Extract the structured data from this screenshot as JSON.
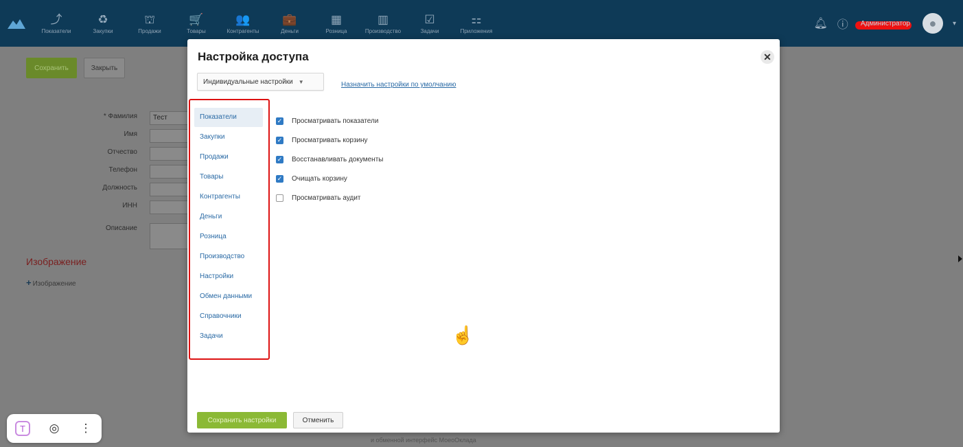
{
  "nav": {
    "items": [
      {
        "label": "Показатели",
        "icon": "chart-line-icon",
        "glyph": "⤴"
      },
      {
        "label": "Закупки",
        "icon": "purchases-icon",
        "glyph": "♻"
      },
      {
        "label": "Продажи",
        "icon": "bag-icon",
        "glyph": "⛫"
      },
      {
        "label": "Товары",
        "icon": "cart-icon",
        "glyph": "🛒"
      },
      {
        "label": "Контрагенты",
        "icon": "people-icon",
        "glyph": "👥"
      },
      {
        "label": "Деньги",
        "icon": "wallet-icon",
        "glyph": "💼"
      },
      {
        "label": "Розница",
        "icon": "register-icon",
        "glyph": "▦"
      },
      {
        "label": "Производство",
        "icon": "factory-icon",
        "glyph": "▥"
      },
      {
        "label": "Задачи",
        "icon": "tasks-icon",
        "glyph": "☑"
      },
      {
        "label": "Приложения",
        "icon": "apps-icon",
        "glyph": "⚏"
      }
    ],
    "user": "Администратор"
  },
  "page": {
    "save_label": "Сохранить",
    "close_label": "Закрыть",
    "fields": [
      {
        "label": "* Фамилия",
        "value": "Тест"
      },
      {
        "label": "Имя",
        "value": ""
      },
      {
        "label": "Отчество",
        "value": ""
      },
      {
        "label": "Телефон",
        "value": ""
      },
      {
        "label": "Должность",
        "value": ""
      },
      {
        "label": "ИНН",
        "value": ""
      },
      {
        "label": "Описание",
        "value": ""
      }
    ],
    "image_title": "Изображение",
    "image_add": "Изображение",
    "footer_note": "и обменной интерфейс МоеоОклада"
  },
  "modal": {
    "title": "Настройка доступа",
    "select_value": "Индивидуальные настройки",
    "default_link": "Назначить настройки по умолчанию",
    "sections": [
      "Показатели",
      "Закупки",
      "Продажи",
      "Товары",
      "Контрагенты",
      "Деньги",
      "Розница",
      "Производство",
      "Настройки",
      "Обмен данными",
      "Справочники",
      "Задачи"
    ],
    "active_section": "Показатели",
    "permissions": [
      {
        "label": "Просматривать показатели",
        "checked": true
      },
      {
        "label": "Просматривать корзину",
        "checked": true
      },
      {
        "label": "Восстанавливать документы",
        "checked": true
      },
      {
        "label": "Очищать корзину",
        "checked": true
      },
      {
        "label": "Просматривать аудит",
        "checked": false
      }
    ],
    "save_settings_label": "Сохранить настройки",
    "cancel_label": "Отменить"
  },
  "colors": {
    "nav_bg": "#0e3a57",
    "accent_green": "#8bb935",
    "link_blue": "#2a6aa5",
    "highlight_red": "#dd1111"
  }
}
